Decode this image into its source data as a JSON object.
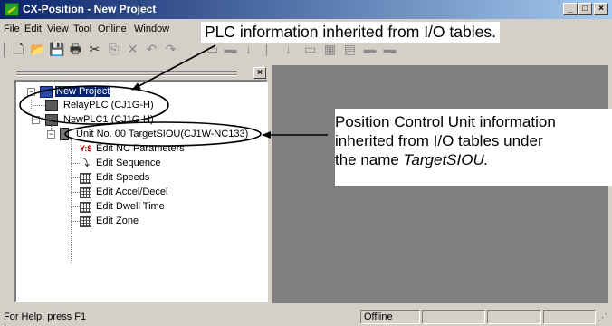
{
  "window": {
    "title": "CX-Position - New Project",
    "controls": {
      "minimize": "_",
      "maximize": "□",
      "close": "×"
    }
  },
  "menu": [
    "File",
    "Edit",
    "View",
    "Tool",
    "Online",
    "Window"
  ],
  "tree": {
    "close_label": "×",
    "project": "New Project",
    "plc1": "RelayPLC (CJ1G-H)",
    "plc2": "NewPLC1 (CJ1G-H)",
    "unit": "Unit No. 00 TargetSIOU(CJ1W-NC133)",
    "items": [
      "Edit NC Parameters",
      "Edit Sequence",
      "Edit Speeds",
      "Edit Accel/Decel",
      "Edit Dwell Time",
      "Edit Zone"
    ]
  },
  "status": {
    "help": "For Help, press F1",
    "mode": "Offline"
  },
  "annotations": {
    "plc_info": "PLC information inherited from I/O tables.",
    "unit_info_lines": [
      "Position Control Unit information",
      "inherited from I/O tables under"
    ],
    "unit_info_last_prefix": "the name ",
    "unit_info_last_name": "TargetSIOU."
  },
  "colors": {
    "titlebar_start": "#0a246a",
    "titlebar_end": "#a6caf0",
    "selection": "#0a246a",
    "workspace": "#808080"
  }
}
